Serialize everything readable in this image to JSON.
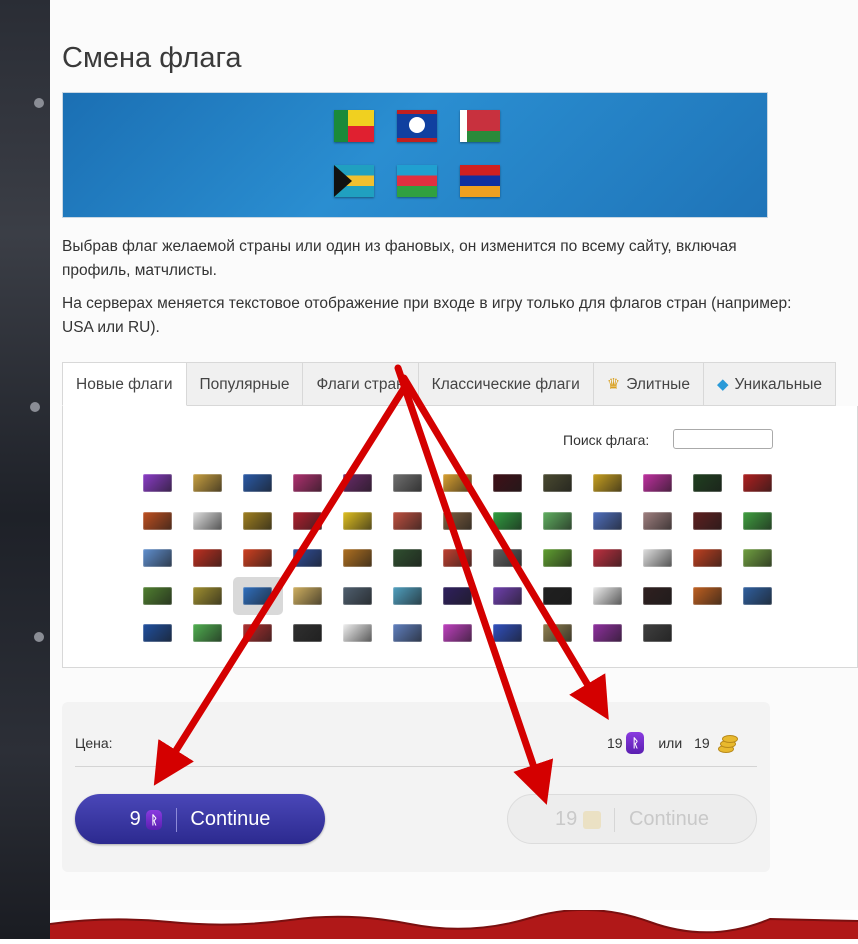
{
  "page": {
    "title": "Смена флага",
    "desc1": "Выбрав флаг желаемой страны или один из фановых, он изменится по всему сайту, включая профиль, матчлисты.",
    "desc2": "На серверах меняется текстовое отображение при входе в игру только для флагов стран (например: USA или RU)."
  },
  "tabs": [
    {
      "label": "Новые флаги",
      "active": true
    },
    {
      "label": "Популярные"
    },
    {
      "label": "Флаги стран"
    },
    {
      "label": "Классические флаги"
    },
    {
      "label": "Элитные",
      "icon": "crown-icon"
    },
    {
      "label": "Уникальные",
      "icon": "diamond-icon"
    }
  ],
  "search": {
    "label": "Поиск флага:",
    "value": ""
  },
  "flags_icons": [
    [
      "#8b3cc8",
      "#c9a040",
      "#2a5aa8",
      "#b03070",
      "#6a2a6a",
      "#707070",
      "#d9a030",
      "#401018",
      "#4a4a30",
      "#c8a020",
      "#c030a0",
      "#204020",
      "#b02020"
    ],
    [
      "#c05020",
      "#e0e0e0",
      "#a08020",
      "#b02030",
      "#e0c020",
      "#c05040",
      "#806040",
      "#30a040",
      "#60b060",
      "#5070c0",
      "#a08080",
      "#602020",
      "#40a040"
    ],
    [
      "#6090d0",
      "#c03020",
      "#d04020",
      "#3050a0",
      "#b07020",
      "#305030",
      "#c04030",
      "#606060",
      "#60a030",
      "#c03040",
      "#e0e0e0",
      "#c04020",
      "#70a040"
    ],
    [
      "#508030",
      "#a09030",
      "#3070c0",
      "#d0b060",
      "#506070",
      "#50a0c0",
      "#302060",
      "#7040b0",
      "#202020",
      "#f0f0f0",
      "#302020",
      "#c06020",
      "#3060a0"
    ],
    [
      "#2050a0",
      "#50b050",
      "#b03030",
      "#303030",
      "#f0f0f0",
      "#6080c0",
      "#c040c0",
      "#3050c0",
      "#908050",
      "#9030a0",
      "#404040"
    ]
  ],
  "selected_flag": "row4-col3",
  "price": {
    "label": "Цена:",
    "runes": "19",
    "or": "или",
    "coins": "19"
  },
  "buttons": {
    "primary_amount": "9",
    "primary_label": "Continue",
    "secondary_amount": "19",
    "secondary_label": "Continue"
  },
  "colors": {
    "banner": "#1f7ac0",
    "primary_button": "#35329e",
    "arrow": "#d40000"
  }
}
